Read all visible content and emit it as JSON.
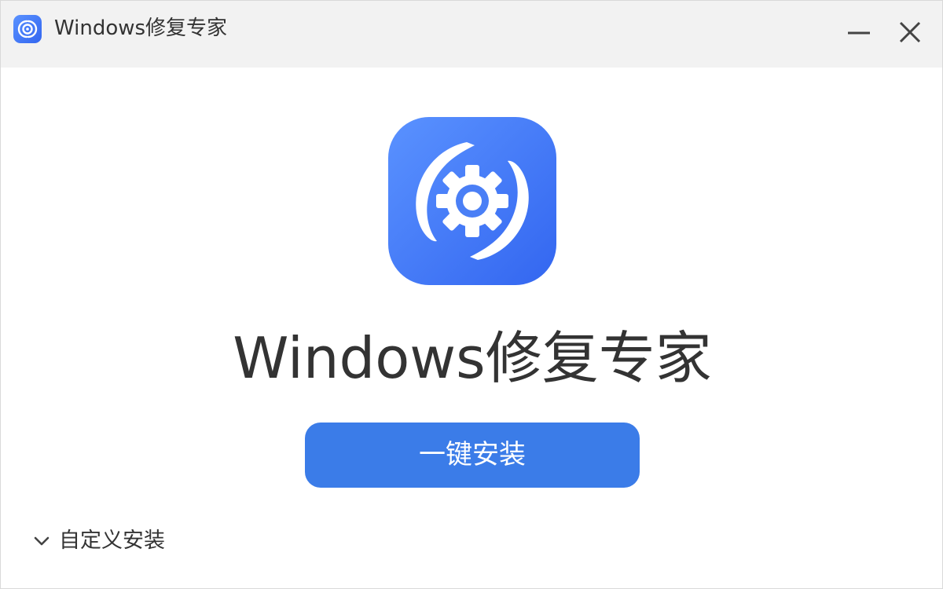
{
  "window": {
    "title": "Windows修复专家",
    "title_icon": "app-gear-icon",
    "controls": {
      "minimize_icon": "minimize-icon",
      "close_icon": "close-icon"
    }
  },
  "main": {
    "logo_icon": "repair-gear-logo-icon",
    "app_name": "Windows修复专家",
    "install_button_label": "一键安装",
    "custom_install_label": "自定义安装",
    "custom_install_icon": "chevron-down-icon"
  },
  "colors": {
    "accent": "#3b7ce8",
    "logo_gradient_start": "#5a92ff",
    "logo_gradient_end": "#3366f0",
    "titlebar_bg": "#f2f2f2",
    "text": "#333333"
  }
}
